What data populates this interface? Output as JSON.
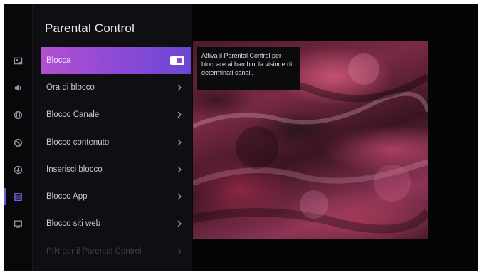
{
  "panel": {
    "title": "Parental Control"
  },
  "rail": {
    "icons": [
      "picture-settings-icon",
      "sound-icon",
      "globe-icon",
      "block-icon",
      "download-icon",
      "list-icon",
      "display-icon"
    ],
    "active_index": 5
  },
  "menu": {
    "items": [
      {
        "label": "Blocca",
        "control": "toggle",
        "toggle_on": true,
        "selected": true
      },
      {
        "label": "Ora di blocco",
        "control": "chevron"
      },
      {
        "label": "Blocco Canale",
        "control": "chevron"
      },
      {
        "label": "Blocco contenuto",
        "control": "chevron"
      },
      {
        "label": "Inserisci blocco",
        "control": "chevron"
      },
      {
        "label": "Blocco App",
        "control": "chevron"
      },
      {
        "label": "Blocco siti web",
        "control": "chevron"
      },
      {
        "label": "PIN per il Parental Control",
        "control": "chevron",
        "dimmed": true
      }
    ]
  },
  "tooltip": {
    "text": "Attiva il Parental Control per bloccare ai bambini la visione di determinati canali."
  },
  "colors": {
    "accent_start": "#b34fd0",
    "accent_end": "#6a47d4",
    "background": "#050507",
    "panel": "#0f0f13"
  }
}
